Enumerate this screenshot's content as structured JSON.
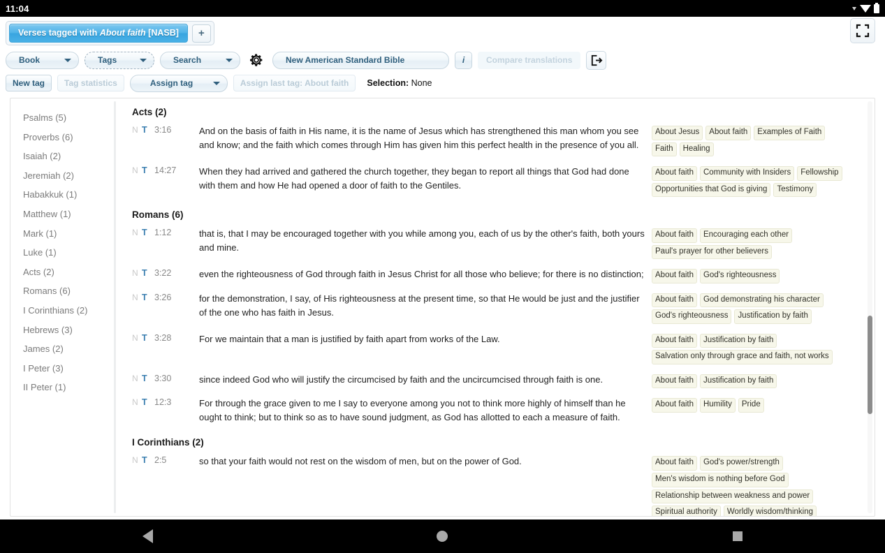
{
  "statusbar": {
    "clock": "11:04",
    "icons": [
      "dropdown-caret",
      "wifi-icon",
      "battery-icon"
    ]
  },
  "tabs": {
    "active_label_prefix": "Verses tagged with ",
    "active_label_em": "About faith",
    "active_label_suffix": " [NASB]",
    "add_tab_label": "+",
    "fullscreen_icon": "fullscreen-icon"
  },
  "toolbar1": {
    "book": "Book",
    "tags": "Tags",
    "search": "Search",
    "settings_icon": "gear-icon",
    "translation": "New American Standard Bible",
    "info": "i",
    "compare": "Compare translations",
    "export_icon": "export-icon"
  },
  "toolbar2": {
    "new_tag": "New tag",
    "tag_statistics": "Tag statistics",
    "assign_tag": "Assign tag",
    "assign_last_tag": "Assign last tag: About faith",
    "selection_label": "Selection:",
    "selection_value": "None"
  },
  "sidebar": {
    "items": [
      "Psalms (5)",
      "Proverbs (6)",
      "Isaiah (2)",
      "Jeremiah (2)",
      "Habakkuk (1)",
      "Matthew (1)",
      "Mark (1)",
      "Luke (1)",
      "Acts (2)",
      "Romans (6)",
      "I Corinthians (2)",
      "Hebrews (3)",
      "James (2)",
      "I Peter (3)",
      "II Peter (1)"
    ]
  },
  "sections": [
    {
      "heading": "Acts (2)",
      "verses": [
        {
          "n": "N",
          "t": "T",
          "ref": "3:16",
          "text": "And on the basis of faith in His name, it is the name of Jesus which has strengthened this man whom you see and know; and the faith which comes through Him has given him this perfect health in the presence of you all.",
          "tags": [
            "About Jesus",
            "About faith",
            "Examples of Faith",
            "Faith",
            "Healing"
          ]
        },
        {
          "n": "N",
          "t": "T",
          "ref": "14:27",
          "text": "When they had arrived and gathered the church together, they began to report all things that God had done with them and how He had opened a door of faith to the Gentiles.",
          "tags": [
            "About faith",
            "Community with Insiders",
            "Fellowship",
            "Opportunities that God is giving",
            "Testimony"
          ]
        }
      ]
    },
    {
      "heading": "Romans (6)",
      "verses": [
        {
          "n": "N",
          "t": "T",
          "ref": "1:12",
          "text": "that is, that I may be encouraged together with you while among you, each of us by the other's faith, both yours and mine.",
          "tags": [
            "About faith",
            "Encouraging each other",
            "Paul's prayer for other believers"
          ]
        },
        {
          "n": "N",
          "t": "T",
          "ref": "3:22",
          "text": "even the righteousness of God through faith in Jesus Christ for all those who believe; for there is no distinction;",
          "tags": [
            "About faith",
            "God's righteousness"
          ]
        },
        {
          "n": "N",
          "t": "T",
          "ref": "3:26",
          "text": "for the demonstration, I say, of His righteousness at the present time, so that He would be just and the justifier of the one who has faith in Jesus.",
          "tags": [
            "About faith",
            "God demonstrating his character",
            "God's righteousness",
            "Justification by faith"
          ]
        },
        {
          "n": "N",
          "t": "T",
          "ref": "3:28",
          "text": "For we maintain that a man is justified by faith apart from works of the Law.",
          "tags": [
            "About faith",
            "Justification by faith",
            "Salvation only through grace and faith, not works"
          ]
        },
        {
          "n": "N",
          "t": "T",
          "ref": "3:30",
          "text": "since indeed God who will justify the circumcised by faith and the uncircumcised through faith is one.",
          "tags": [
            "About faith",
            "Justification by faith"
          ]
        },
        {
          "n": "N",
          "t": "T",
          "ref": "12:3",
          "text": "For through the grace given to me I say to everyone among you not to think more highly of himself than he ought to think; but to think so as to have sound judgment, as God has allotted to each a measure of faith.",
          "tags": [
            "About faith",
            "Humility",
            "Pride"
          ]
        }
      ]
    },
    {
      "heading": "I Corinthians (2)",
      "verses": [
        {
          "n": "N",
          "t": "T",
          "ref": "2:5",
          "text": "so that your faith would not rest on the wisdom of men, but on the power of God.",
          "tags": [
            "About faith",
            "God's power/strength",
            "Men's wisdom is nothing before God",
            "Relationship between weakness and power",
            "Spiritual authority",
            "Worldly wisdom/thinking"
          ]
        }
      ]
    }
  ],
  "scrollbar": {
    "thumb_top_pct": 52,
    "thumb_height_pct": 24
  },
  "navbar": {
    "back": "back-icon",
    "home": "home-icon",
    "recents": "recents-icon"
  },
  "colors": {
    "accent": "#38a5e0",
    "tag_bg": "#f7f7ea",
    "tag_border": "#e8e8d4",
    "button_text": "#2f5f7d",
    "marker_t": "#3b7fb0"
  }
}
